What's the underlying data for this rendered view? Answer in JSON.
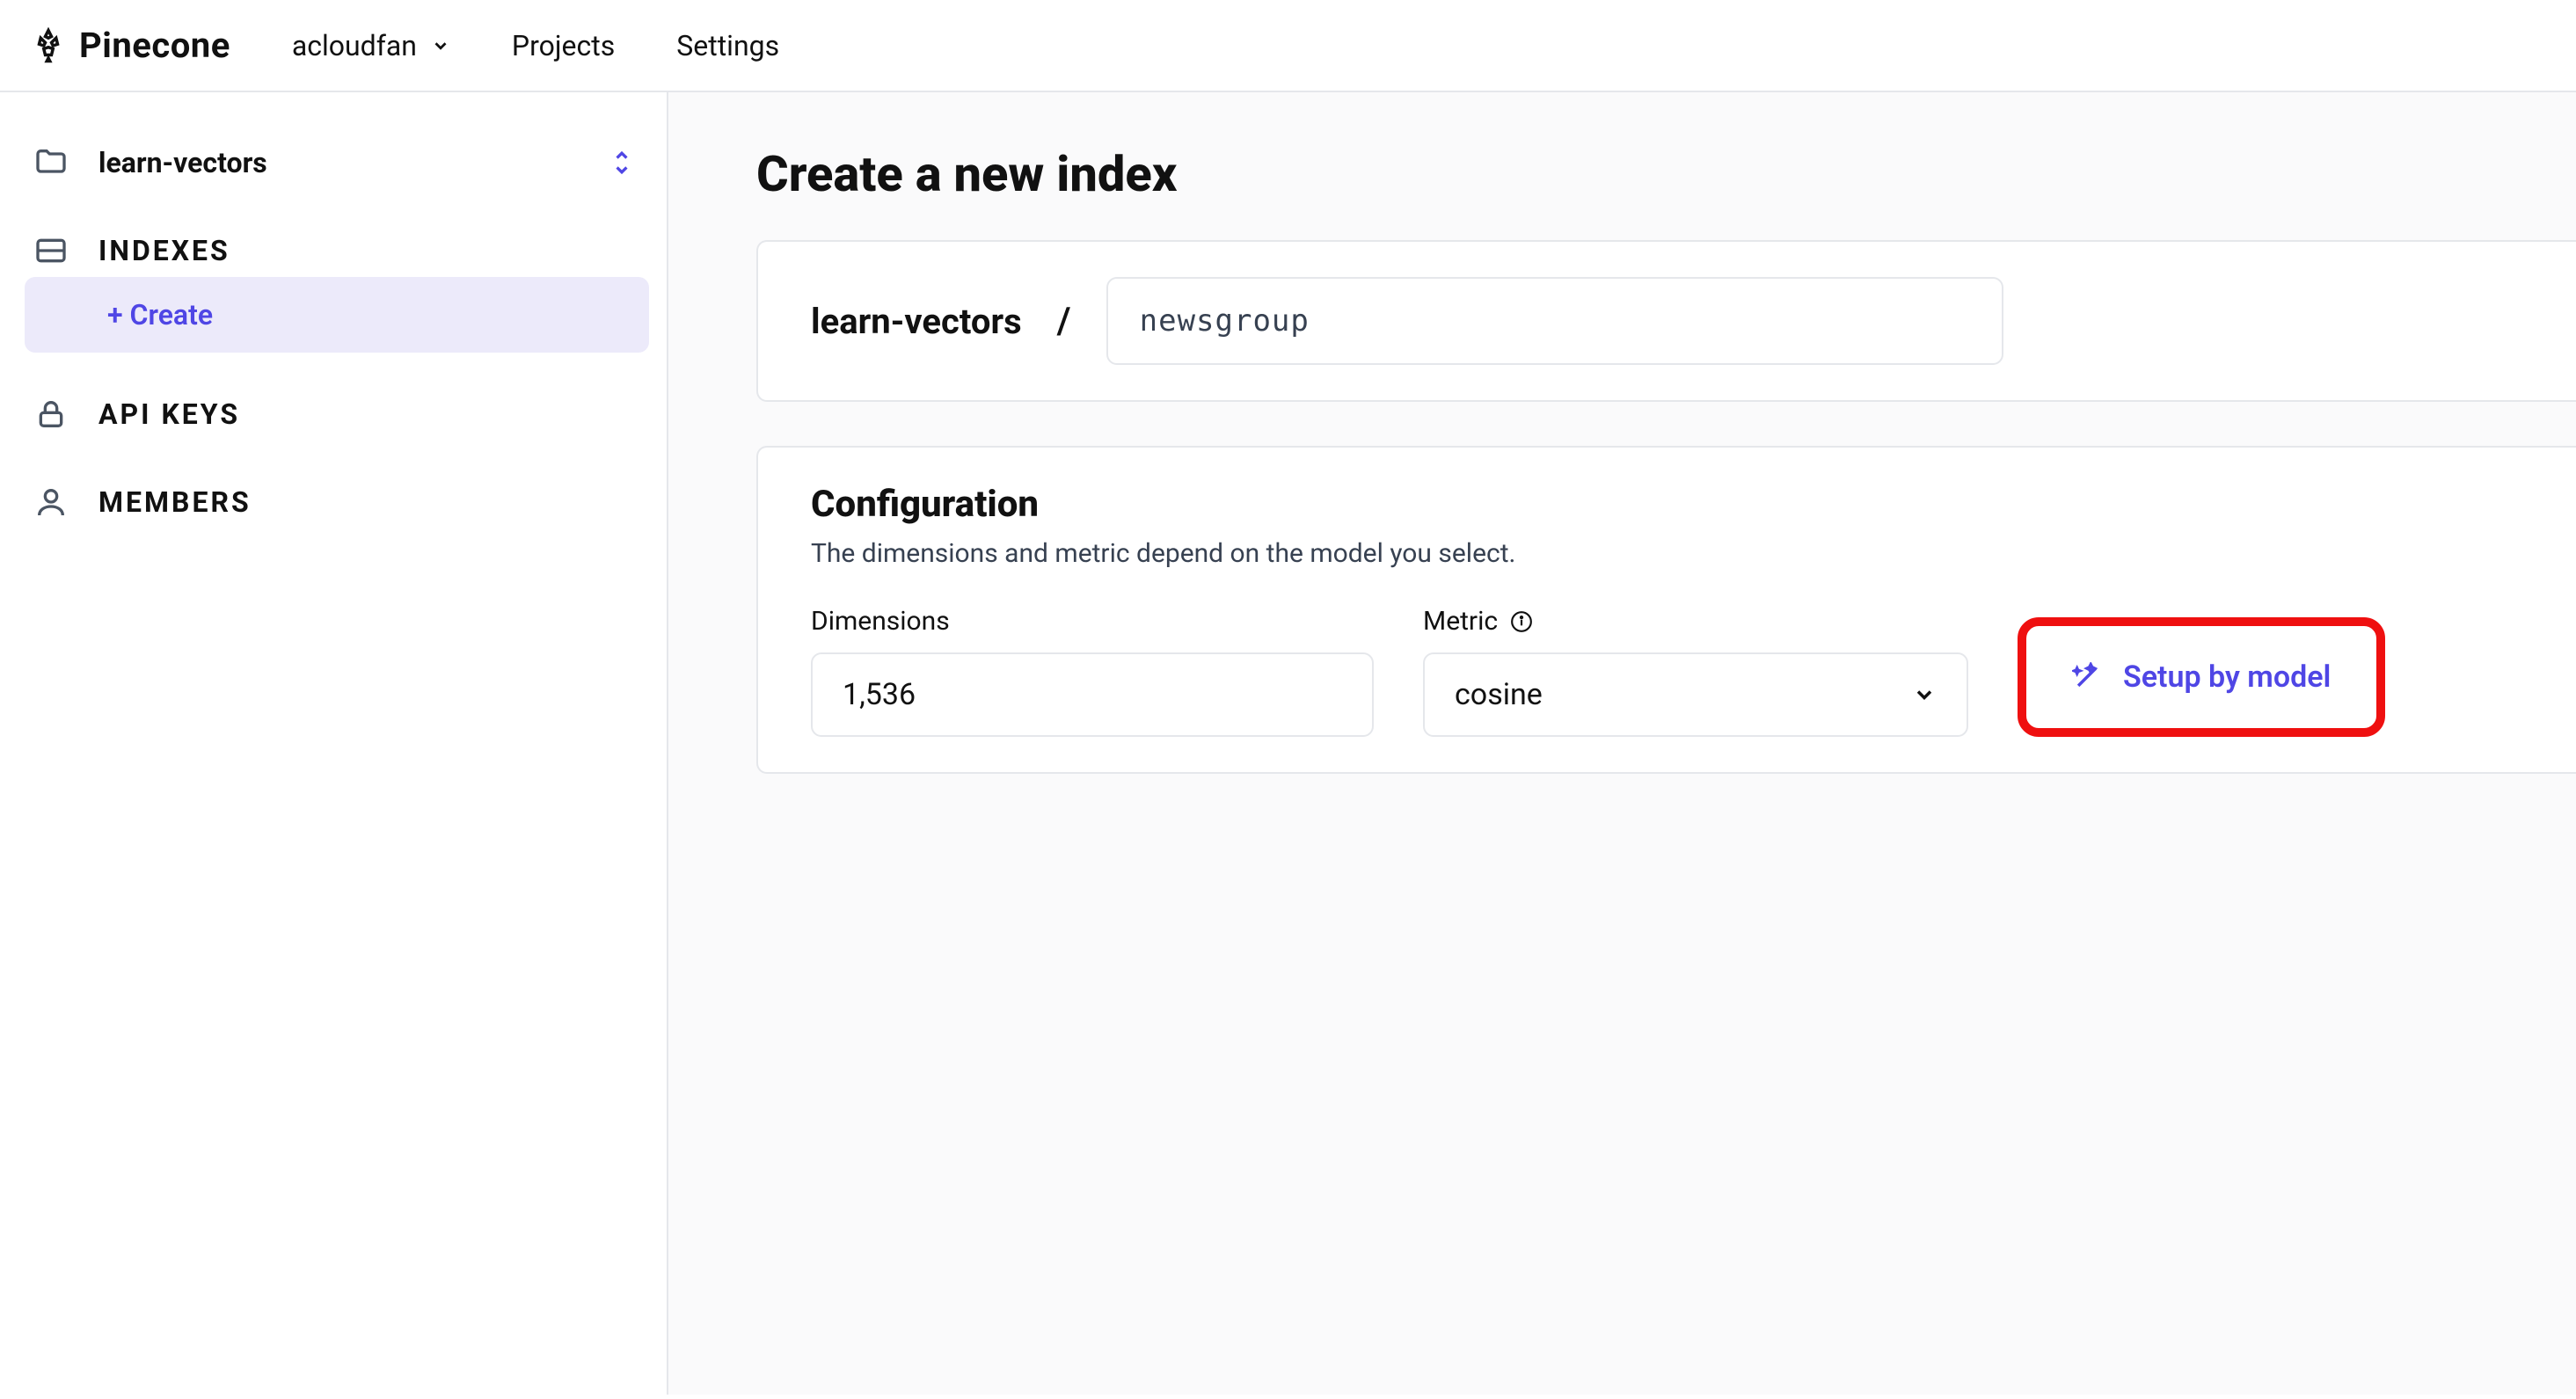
{
  "header": {
    "brand": "Pinecone",
    "user": "acloudfan",
    "nav": {
      "projects": "Projects",
      "settings": "Settings"
    }
  },
  "sidebar": {
    "project": "learn-vectors",
    "indexes_label": "INDEXES",
    "create_label": "+ Create",
    "api_keys_label": "API KEYS",
    "members_label": "MEMBERS"
  },
  "main": {
    "title": "Create a new index",
    "breadcrumb": {
      "project": "learn-vectors",
      "slash": "/"
    },
    "name_input": {
      "value": "newsgroup"
    },
    "config": {
      "heading": "Configuration",
      "description": "The dimensions and metric depend on the model you select.",
      "dimensions": {
        "label": "Dimensions",
        "value": "1,536"
      },
      "metric": {
        "label": "Metric",
        "value": "cosine"
      },
      "setup_by_model": "Setup by model"
    }
  }
}
